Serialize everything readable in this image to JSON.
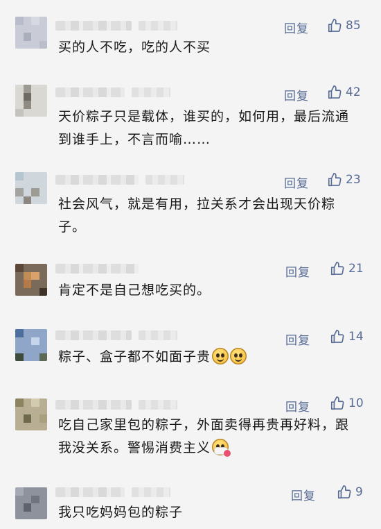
{
  "reply_label": "回复",
  "comments": [
    {
      "likes": "85",
      "text": "买的人不吃，吃的人不买"
    },
    {
      "likes": "42",
      "text": "天价粽子只是载体，谁买的，如何用，最后流通到谁手上，不言而喻……"
    },
    {
      "likes": "23",
      "text": "社会风气，就是有用，拉关系才会出现天价粽子。"
    },
    {
      "likes": "21",
      "text": "肯定不是自己想吃买的。"
    },
    {
      "likes": "14",
      "text": "粽子、盒子都不如面子贵",
      "emoji": [
        "smiling-face-icon",
        "smiling-face-icon"
      ]
    },
    {
      "likes": "10",
      "text": "吃自己家里包的粽子，外面卖得再贵再好料，跟我没关系。警惕消费主义",
      "emoji": [
        "face-with-mask-icon"
      ]
    },
    {
      "likes": "9",
      "text": "我只吃妈妈包的粽子"
    }
  ],
  "colors": {
    "link": "#576b95",
    "text": "#191919",
    "background": "#f4f4f4"
  }
}
